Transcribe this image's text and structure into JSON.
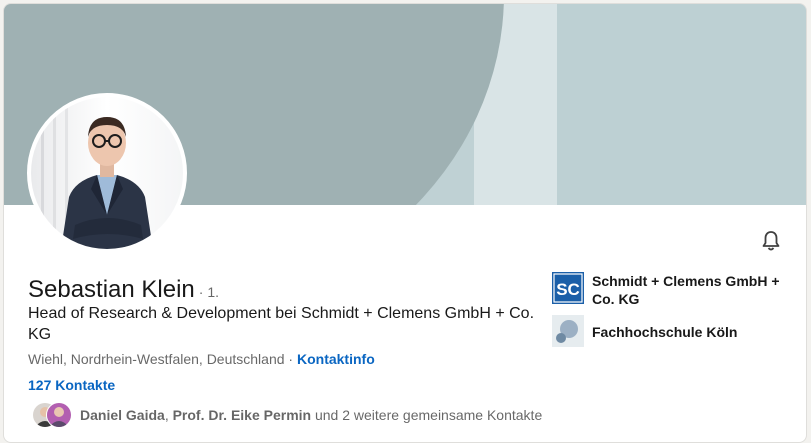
{
  "profile": {
    "name": "Sebastian Klein",
    "degree": "· 1.",
    "headline": "Head of Research & Development bei Schmidt + Clemens GmbH + Co. KG",
    "location": "Wiehl, Nordrhein-Westfalen, Deutschland",
    "location_separator": " · ",
    "contact_info_link": "Kontaktinfo",
    "connections": "127 Kontakte",
    "mutual": {
      "person1": "Daniel Gaida",
      "separator": ", ",
      "person2": "Prof. Dr. Eike Permin",
      "rest": " und 2 weitere gemeinsame Kontakte"
    }
  },
  "experience": {
    "company": "Schmidt + Clemens GmbH + Co. KG",
    "company_logo_text": "SC"
  },
  "education": {
    "school": "Fachhochschule Köln"
  },
  "icons": {
    "notification": "bell-icon"
  },
  "colors": {
    "link": "#0a66c2",
    "banner_dark": "#9fb1b3",
    "banner_light": "#bdd0d3",
    "company_logo": "#1b5fa8"
  }
}
